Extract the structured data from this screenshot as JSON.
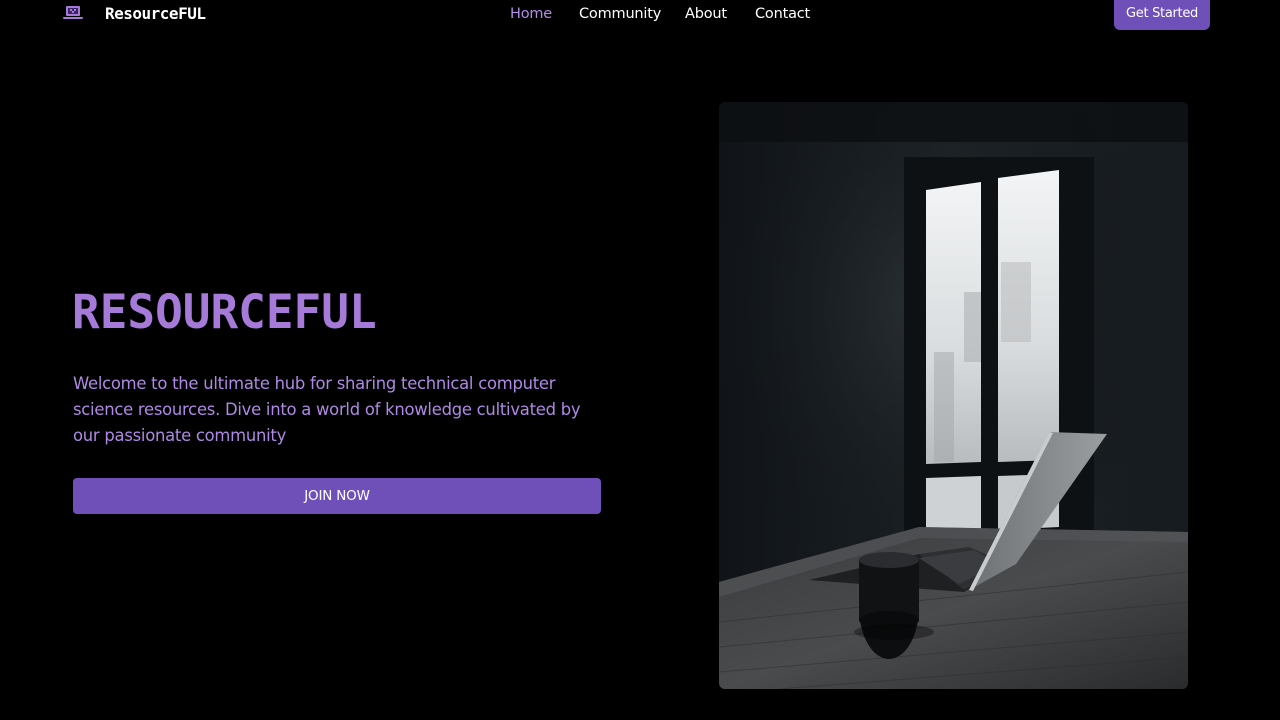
{
  "header": {
    "logo_text": "ResourceFUL",
    "nav": [
      {
        "label": "Home",
        "active": true
      },
      {
        "label": "Community",
        "active": false
      },
      {
        "label": "About",
        "active": false
      },
      {
        "label": "Contact",
        "active": false
      }
    ],
    "cta_label": "Get Started"
  },
  "hero": {
    "title": "RESOURCEFUL",
    "description": "Welcome to the ultimate hub for sharing technical computer science resources. Dive into a world of knowledge cultivated by our passionate community",
    "join_label": "JOIN NOW"
  },
  "colors": {
    "background": "#000000",
    "accent": "#6f4fb8",
    "accent_text": "#b088e6",
    "nav_active": "#b48be8",
    "text": "#ffffff"
  },
  "icons": {
    "logo": "laptop-icon"
  }
}
